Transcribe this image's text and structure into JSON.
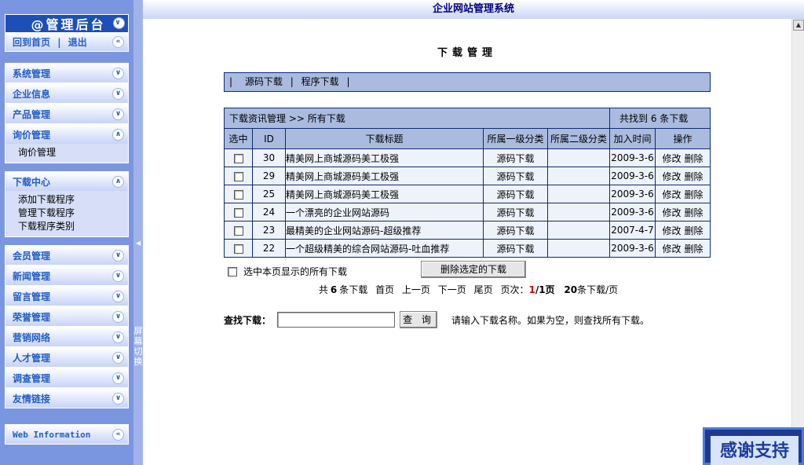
{
  "window_title": "企业网站管理系统",
  "sidebar": {
    "header_title": "@管理后台",
    "back_links": {
      "home": "回到首页",
      "sep": "|",
      "logout": "退出"
    },
    "groups_top": [
      {
        "label": "系统管理"
      },
      {
        "label": "企业信息"
      },
      {
        "label": "产品管理"
      },
      {
        "label": "询价管理",
        "items": [
          "询价管理"
        ]
      }
    ],
    "download_center": {
      "label": "下载中心",
      "items": [
        "添加下载程序",
        "管理下载程序",
        "下载程序类别"
      ]
    },
    "groups_bottom": [
      {
        "label": "会员管理"
      },
      {
        "label": "新闻管理"
      },
      {
        "label": "留言管理"
      },
      {
        "label": "荣誉管理"
      },
      {
        "label": "营销网络"
      },
      {
        "label": "人才管理"
      },
      {
        "label": "调查管理"
      },
      {
        "label": "友情链接"
      }
    ],
    "web_info": "Web Information",
    "screen_switch": "屏幕切换"
  },
  "main": {
    "page_title": "下载管理",
    "category_bar": {
      "sep": "|",
      "items": [
        "源码下载",
        "程序下载"
      ]
    },
    "list": {
      "breadcrumb": "下载资讯管理 >> 所有下载",
      "found_text": "共找到 6 条下载",
      "columns": [
        "选中",
        "ID",
        "下载标题",
        "所属一级分类",
        "所属二级分类",
        "加入时间",
        "操作"
      ],
      "rows": [
        {
          "id": "30",
          "title": "精美网上商城源码美工极强",
          "cat1": "源码下载",
          "cat2": "",
          "date": "2009-3-6",
          "edit": "修改",
          "del": "删除"
        },
        {
          "id": "29",
          "title": "精美网上商城源码美工极强",
          "cat1": "源码下载",
          "cat2": "",
          "date": "2009-3-6",
          "edit": "修改",
          "del": "删除"
        },
        {
          "id": "25",
          "title": "精美网上商城源码美工极强",
          "cat1": "源码下载",
          "cat2": "",
          "date": "2009-3-6",
          "edit": "修改",
          "del": "删除"
        },
        {
          "id": "24",
          "title": "一个漂亮的企业网站源码",
          "cat1": "源码下载",
          "cat2": "",
          "date": "2009-3-6",
          "edit": "修改",
          "del": "删除"
        },
        {
          "id": "23",
          "title": "最精美的企业网站源码-超级推荐",
          "cat1": "源码下载",
          "cat2": "",
          "date": "2007-4-7",
          "edit": "修改",
          "del": "删除"
        },
        {
          "id": "22",
          "title": "一个超级精美的综合网站源码-吐血推荐",
          "cat1": "源码下载",
          "cat2": "",
          "date": "2009-3-6",
          "edit": "修改",
          "del": "删除"
        }
      ]
    },
    "select_all_label": "选中本页显示的所有下载",
    "delete_button": "删除选定的下载",
    "pager": {
      "total_prefix": "共",
      "total": "6",
      "total_suffix": "条下载",
      "first": "首页",
      "prev": "上一页",
      "next": "下一页",
      "last": "尾页",
      "page_label": "页次：",
      "current": "1",
      "of": "/1页",
      "per_page": "20",
      "per_page_suffix": "条下载/页"
    },
    "search": {
      "label": "查找下载：",
      "value": "",
      "button": "查 询",
      "hint": "请输入下载名称。如果为空，则查找所有下载。"
    }
  },
  "thanks_badge": "感谢支持",
  "colors": {
    "sidebar_bg": "#7b96e0",
    "header_dark": "#1c4fb8",
    "table_header": "#aabbdf",
    "border": "#0f2b6e"
  }
}
